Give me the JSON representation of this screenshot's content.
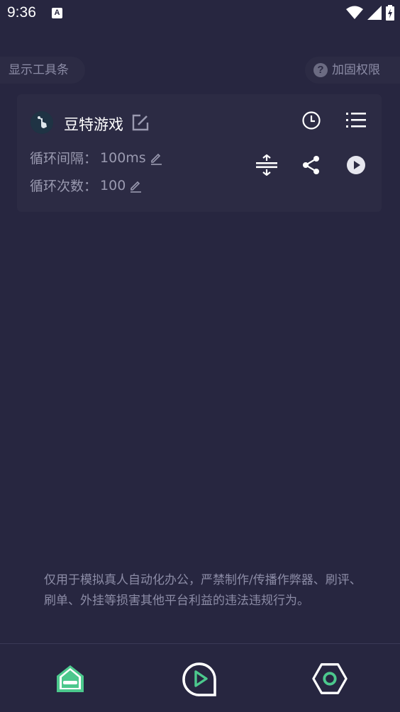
{
  "status_bar": {
    "time": "9:36",
    "notification_icon": "A",
    "icons": [
      "wifi-icon",
      "signal-icon",
      "battery-charging-icon"
    ]
  },
  "toolbar": {
    "show_toolbar_label": "显示工具条",
    "reinforce_permission_label": "加固权限",
    "help_icon_glyph": "?"
  },
  "script_card": {
    "app_icon": "app-icon",
    "title": "豆特游戏",
    "loop_interval_label": "循环间隔：",
    "loop_interval_value": "100ms",
    "loop_count_label": "循环次数：",
    "loop_count_value": "100",
    "actions": [
      "clock-icon",
      "list-icon",
      "split-icon",
      "share-icon",
      "play-icon"
    ]
  },
  "notice": {
    "text": "仅用于模拟真人自动化办公，严禁制作/传播作弊器、刷评、刷单、外挂等损害其他平台利益的违法违规行为。"
  },
  "bottom_nav": {
    "items": [
      "home-icon",
      "play-record-icon",
      "settings-hexagon-icon"
    ],
    "accent": "#4cc88d"
  }
}
